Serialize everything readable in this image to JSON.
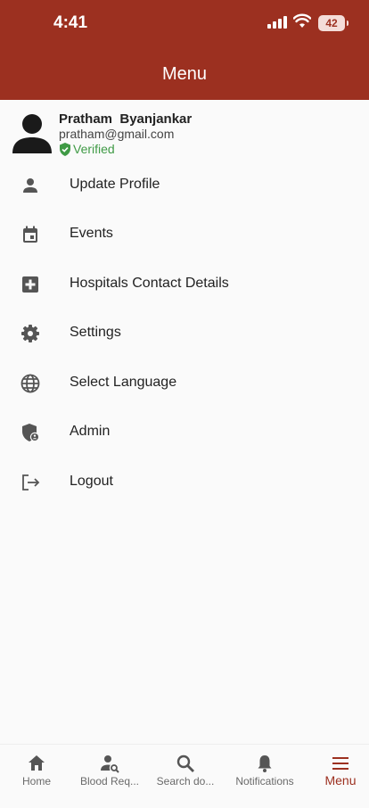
{
  "status_bar": {
    "time": "4:41",
    "battery": "42"
  },
  "header": {
    "title": "Menu"
  },
  "profile": {
    "name": "Pratham  Byanjankar",
    "email": "pratham@gmail.com",
    "verified_label": "Verified"
  },
  "menu": {
    "items": [
      {
        "label": "Update Profile",
        "icon": "person-icon"
      },
      {
        "label": "Events",
        "icon": "calendar-icon"
      },
      {
        "label": "Hospitals Contact Details",
        "icon": "hospital-icon"
      },
      {
        "label": "Settings",
        "icon": "gear-icon"
      },
      {
        "label": "Select Language",
        "icon": "globe-icon"
      },
      {
        "label": "Admin",
        "icon": "admin-shield-icon"
      },
      {
        "label": "Logout",
        "icon": "logout-icon"
      }
    ]
  },
  "bottom_nav": {
    "items": [
      {
        "label": "Home",
        "icon": "home-icon"
      },
      {
        "label": "Blood Req...",
        "icon": "person-search-icon"
      },
      {
        "label": "Search do...",
        "icon": "search-icon"
      },
      {
        "label": "Notifications",
        "icon": "bell-icon"
      },
      {
        "label": "Menu",
        "icon": "menu-icon",
        "active": true
      }
    ]
  },
  "colors": {
    "primary": "#9c3020",
    "verified": "#3f9a45",
    "icon_grey": "#555555",
    "background": "#fafafa"
  }
}
